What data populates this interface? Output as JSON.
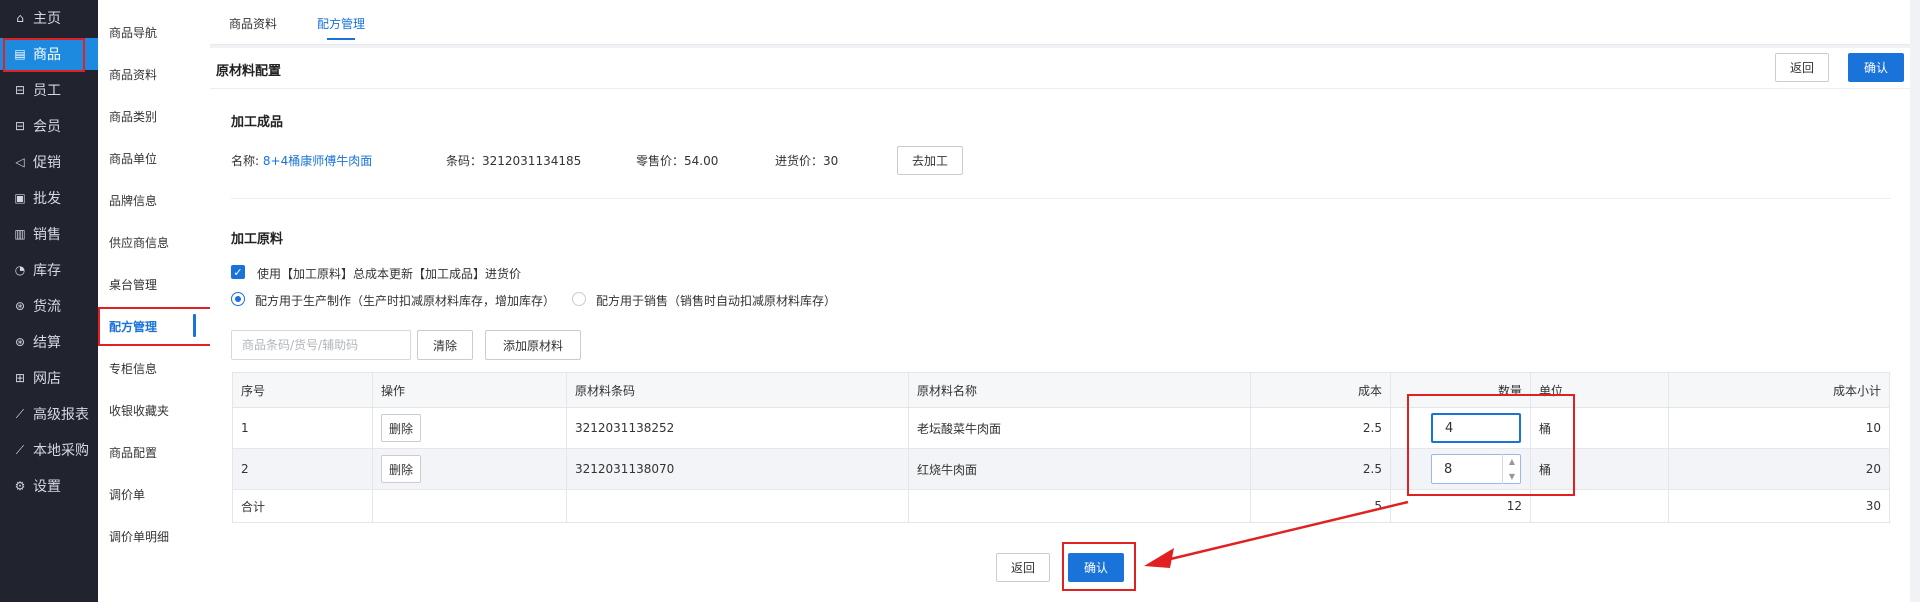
{
  "sidebar": {
    "items": [
      {
        "label": "主页",
        "icon": "home-icon"
      },
      {
        "label": "商品",
        "icon": "goods-icon"
      },
      {
        "label": "员工",
        "icon": "staff-icon"
      },
      {
        "label": "会员",
        "icon": "member-icon"
      },
      {
        "label": "促销",
        "icon": "promotion-icon"
      },
      {
        "label": "批发",
        "icon": "wholesale-icon"
      },
      {
        "label": "销售",
        "icon": "sales-icon"
      },
      {
        "label": "库存",
        "icon": "inventory-icon"
      },
      {
        "label": "货流",
        "icon": "logistics-icon"
      },
      {
        "label": "结算",
        "icon": "settlement-icon"
      },
      {
        "label": "网店",
        "icon": "shop-icon"
      },
      {
        "label": "高级报表",
        "icon": "report-icon"
      },
      {
        "label": "本地采购",
        "icon": "purchase-icon"
      },
      {
        "label": "设置",
        "icon": "settings-icon"
      }
    ],
    "active_index": 1
  },
  "subnav": {
    "items": [
      "商品导航",
      "商品资料",
      "商品类别",
      "商品单位",
      "品牌信息",
      "供应商信息",
      "桌台管理",
      "配方管理",
      "专柜信息",
      "收银收藏夹",
      "商品配置",
      "调价单",
      "调价单明细"
    ],
    "active_index": 7
  },
  "tabs": [
    "商品资料",
    "配方管理"
  ],
  "active_tab": 1,
  "header": {
    "title": "原材料配置",
    "back_label": "返回",
    "confirm_label": "确认"
  },
  "product": {
    "section_title": "加工成品",
    "name_label": "名称:",
    "name_value": "8+4桶康师傅牛肉面",
    "barcode": "条码：3212031134185",
    "retail_price": "零售价：54.00",
    "purchase_price": "进货价：30",
    "process_button": "去加工"
  },
  "materials": {
    "section_title": "加工原料",
    "checkbox_label": "使用【加工原料】总成本更新【加工成品】进货价",
    "radio_production": "配方用于生产制作（生产时扣减原材料库存，增加库存）",
    "radio_sales": "配方用于销售（销售时自动扣减原材料库存）",
    "search_placeholder": "商品条码/货号/辅助码",
    "clear_label": "清除",
    "add_label": "添加原材料"
  },
  "table": {
    "columns": [
      "序号",
      "操作",
      "原材料条码",
      "原材料名称",
      "成本",
      "数量",
      "单位",
      "成本小计"
    ],
    "rows": [
      {
        "index": "1",
        "action": "删除",
        "barcode": "3212031138252",
        "name": "老坛酸菜牛肉面",
        "cost": "2.5",
        "quantity": "4",
        "unit": "桶",
        "subtotal": "10"
      },
      {
        "index": "2",
        "action": "删除",
        "barcode": "3212031138070",
        "name": "红烧牛肉面",
        "cost": "2.5",
        "quantity": "8",
        "unit": "桶",
        "subtotal": "20"
      }
    ],
    "total": {
      "label": "合计",
      "cost": "5",
      "quantity": "12",
      "subtotal": "30"
    }
  },
  "footer": {
    "back_label": "返回",
    "confirm_label": "确认"
  },
  "colors": {
    "accent": "#1a73d9",
    "sidebar_bg": "#21232e",
    "highlight_red": "#e12121"
  }
}
